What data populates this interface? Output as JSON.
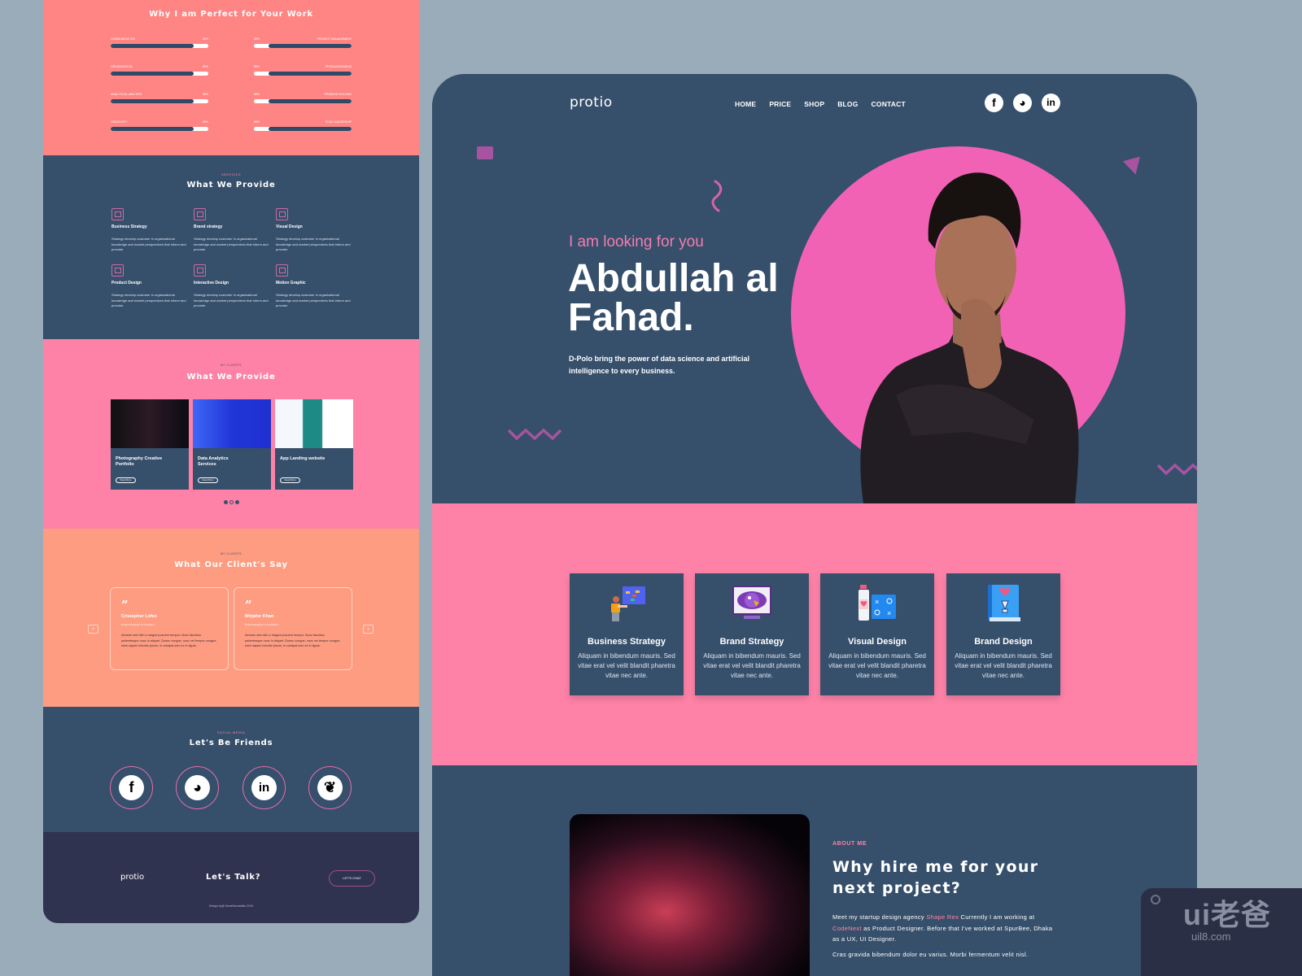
{
  "left_mockup": {
    "skills": {
      "title": "Why I am Perfect for Your Work",
      "left": [
        {
          "label": "Communication",
          "percent_text": "85%",
          "value": 0.85
        },
        {
          "label": "Organization",
          "percent_text": "85%",
          "value": 0.85
        },
        {
          "label": "Analytical Abilities",
          "percent_text": "85%",
          "value": 0.85
        },
        {
          "label": "Creativity",
          "percent_text": "85%",
          "value": 0.85
        }
      ],
      "right": [
        {
          "label": "Project Management",
          "percent_text": "85%",
          "value": 0.85
        },
        {
          "label": "Persuasiveness",
          "percent_text": "85%",
          "value": 0.85
        },
        {
          "label": "Problem Solving",
          "percent_text": "85%",
          "value": 0.85
        },
        {
          "label": "Team Leadership",
          "percent_text": "85%",
          "value": 0.85
        }
      ]
    },
    "services": {
      "eyebrow": "Services",
      "title": "What We Provide",
      "items": [
        {
          "title": "Business Strategy",
          "text": "Strategy develop customer in organizational knowledge and market perspectives that inform and provoke."
        },
        {
          "title": "Brand strategy",
          "text": "Strategy develop customer in organizational knowledge and market perspectives that inform and provoke."
        },
        {
          "title": "Visual Design",
          "text": "Strategy develop customer in organizational knowledge and market perspectives that inform and provoke."
        },
        {
          "title": "Product Design",
          "text": "Strategy develop customer in organizational knowledge and market perspectives that inform and provoke."
        },
        {
          "title": "Interactive Design",
          "text": "Strategy develop customer in organizational knowledge and market perspectives that inform and provoke."
        },
        {
          "title": "Motion Graphic",
          "text": "Strategy develop customer in organizational knowledge and market perspectives that inform and provoke."
        }
      ]
    },
    "work": {
      "eyebrow": "My Clients",
      "title": "What We Provide",
      "cards": [
        {
          "title": "Photography Creative Portfolio",
          "button": "Read More"
        },
        {
          "title": "Data Analytics Services",
          "button": "Read More"
        },
        {
          "title": "App Landing website",
          "button": "Read More"
        }
      ]
    },
    "testimonials": {
      "eyebrow": "My Clients",
      "title": "What Our Client's Say",
      "quote_mark": "”",
      "prev": "‹",
      "next": "›",
      "items": [
        {
          "name": "Cristopher Lofez",
          "role": "Product Designer at CodeNext",
          "text": "Aenean sed nibh a magna posuere tempor. Nunc faucibus pellentesque nunc in aliquet. Donec congue, nunc vel tempor congue, enim sapien lobortis ipsum, in volutpat sem ex in ligula."
        },
        {
          "name": "Mirjafor Khan",
          "role": "Product Designer at CodeNext",
          "text": "Aenean sed nibh a magna posuere tempor. Nunc faucibus pellentesque nunc in aliquet. Donec congue, nunc vel tempor congue, enim sapien lobortis ipsum, in volutpat sem ex in ligula."
        }
      ]
    },
    "social": {
      "eyebrow": "Social Media",
      "title": "Let's Be Friends",
      "icons": [
        "f",
        "◕",
        "in",
        "❦"
      ]
    },
    "footer": {
      "logo": "protio",
      "heading": "Let's Talk?",
      "button": "LET'S CHAT",
      "copyright": "Design by@ ItsmeNomadsito 2019"
    }
  },
  "right_mockup": {
    "logo": "protio",
    "nav": [
      "HOME",
      "PRICE",
      "SHOP",
      "BLOG",
      "CONTACT"
    ],
    "social_icons": [
      "f",
      "◕",
      "in"
    ],
    "hero": {
      "eyebrow": "I am looking for you",
      "name": "Abdullah al Fahad.",
      "tagline": "D-Polo bring the power of data science and artificial intelligence to every business."
    },
    "features": [
      {
        "title": "Business Strategy",
        "text": "Aliquam in bibendum mauris. Sed vitae erat vel velit blandit pharetra vitae nec ante."
      },
      {
        "title": "Brand Strategy",
        "text": "Aliquam in bibendum mauris. Sed vitae erat vel velit blandit pharetra vitae nec ante."
      },
      {
        "title": "Visual Design",
        "text": "Aliquam in bibendum mauris. Sed vitae erat vel velit blandit pharetra vitae nec ante."
      },
      {
        "title": "Brand Design",
        "text": "Aliquam in bibendum mauris. Sed vitae erat vel velit blandit pharetra vitae nec ante."
      }
    ],
    "about": {
      "eyebrow": "ABOUT ME",
      "title": "Why hire me for your next project?",
      "text_1": "Meet my startup design agency ",
      "highlight_1": "Shape Rex",
      "text_2": " Currently I am working at ",
      "highlight_2": "CodeNext",
      "text_3": " as Product Designer. Before that I've worked at SpurBee, Dhaka as a UX, UI Designer.",
      "text_4": "Cras gravida bibendum dolor eu varius. Morbi fermentum velit nisl."
    }
  },
  "watermark": {
    "big": "ui老爸",
    "small": "uil8.com"
  },
  "colors": {
    "navy": "#364f6b",
    "pink": "#fe82a7",
    "hot_pink": "#f162b4",
    "coral": "#fe8583",
    "salmon": "#fd9c81",
    "purple": "#a654a0",
    "footer": "#2f3350"
  }
}
